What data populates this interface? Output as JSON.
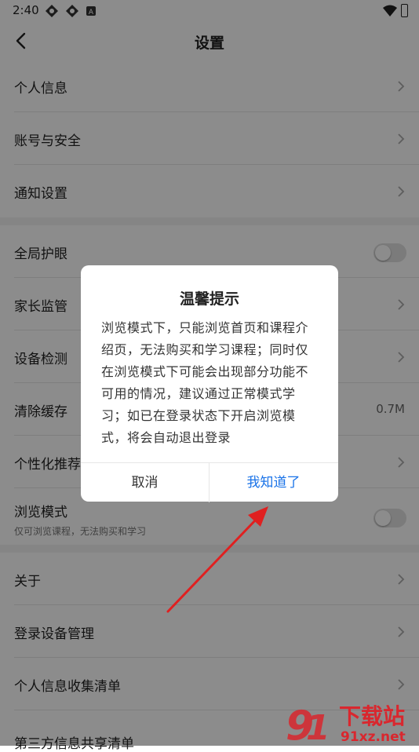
{
  "status_bar": {
    "time": "2:40"
  },
  "header": {
    "title": "设置"
  },
  "settings": {
    "personal_info": "个人信息",
    "account_security": "账号与安全",
    "notification_settings": "通知设置",
    "global_eye_care": "全局护眼",
    "parental_control": "家长监管",
    "device_check": "设备检测",
    "clear_cache": "清除缓存",
    "cache_size": "0.7M",
    "personalized_recommendation": "个性化推荐",
    "browse_mode": "浏览模式",
    "browse_mode_desc": "仅可浏览课程，无法购买和学习",
    "about": "关于",
    "login_device_management": "登录设备管理",
    "personal_info_collection": "个人信息收集清单",
    "third_party_sharing": "第三方信息共享清单"
  },
  "dialog": {
    "title": "温馨提示",
    "message": "浏览模式下，只能浏览首页和课程介绍页，无法购买和学习课程；同时仅在浏览模式下可能会出现部分功能不可用的情况，建议通过正常模式学习；如已在登录状态下开启浏览模式，将会自动退出登录",
    "cancel_label": "取消",
    "confirm_label": "我知道了"
  },
  "watermark": {
    "brand": "下载站",
    "site": "91xz.net"
  },
  "colors": {
    "accent": "#1a73e8",
    "arrow": "#e02020",
    "watermark": "#d9272e"
  }
}
